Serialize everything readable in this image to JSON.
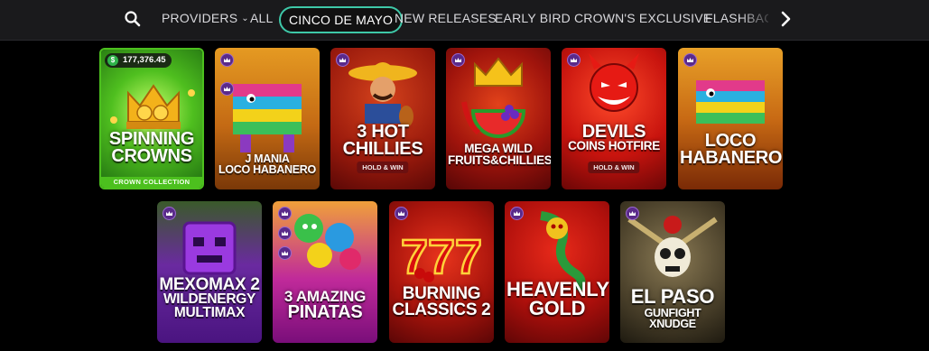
{
  "nav": {
    "providers_label": "PROVIDERS",
    "items": [
      "ALL",
      "CINCO DE MAYO",
      "NEW RELEASES",
      "EARLY BIRD",
      "CROWN'S EXCLUSIVE",
      "FLASHBACK"
    ],
    "active_item": "CINCO DE MAYO",
    "accent_color": "#3ec8a8"
  },
  "row1": [
    {
      "title_lines": [
        "SPINNING",
        "CROWNS"
      ],
      "jackpot": "177,376.45",
      "footer": "CROWN COLLECTION"
    },
    {
      "title_lines": [
        "J MANIA",
        "LOCO HABANERO"
      ]
    },
    {
      "title_lines": [
        "3 HOT",
        "CHILLIES"
      ],
      "badge": "HOLD & WIN"
    },
    {
      "title_lines": [
        "MEGA WILD",
        "FRUITS&CHILLIES"
      ]
    },
    {
      "title_lines": [
        "DEVILS",
        "COINS HOTFIRE"
      ],
      "badge": "HOLD & WIN"
    },
    {
      "title_lines": [
        "LOCO",
        "HABANERO"
      ]
    }
  ],
  "row2": [
    {
      "title_lines": [
        "MEXOMAX 2",
        "WILDENERGY",
        "MULTIMAX"
      ]
    },
    {
      "title_lines": [
        "3 AMAZING",
        "PINATAS"
      ]
    },
    {
      "title_lines": [
        "BURNING",
        "CLASSICS 2"
      ]
    },
    {
      "title_lines": [
        "HEAVENLY",
        "GOLD"
      ]
    },
    {
      "title_lines": [
        "EL PASO",
        "GUNFIGHT XNUDGE"
      ]
    }
  ]
}
